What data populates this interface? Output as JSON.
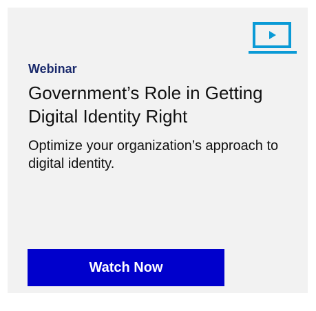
{
  "card": {
    "icon": "video-play-icon",
    "eyebrow": "Webinar",
    "title": "Government’s Role in Getting Digital Identity Right",
    "description": "Optimize your organization’s approach to digital identity.",
    "cta_label": "Watch Now"
  },
  "colors": {
    "background": "#f2f2f2",
    "accent_icon": "#0a9ad6",
    "eyebrow": "#1a2a6c",
    "button": "#0000cc",
    "button_text": "#ffffff"
  }
}
